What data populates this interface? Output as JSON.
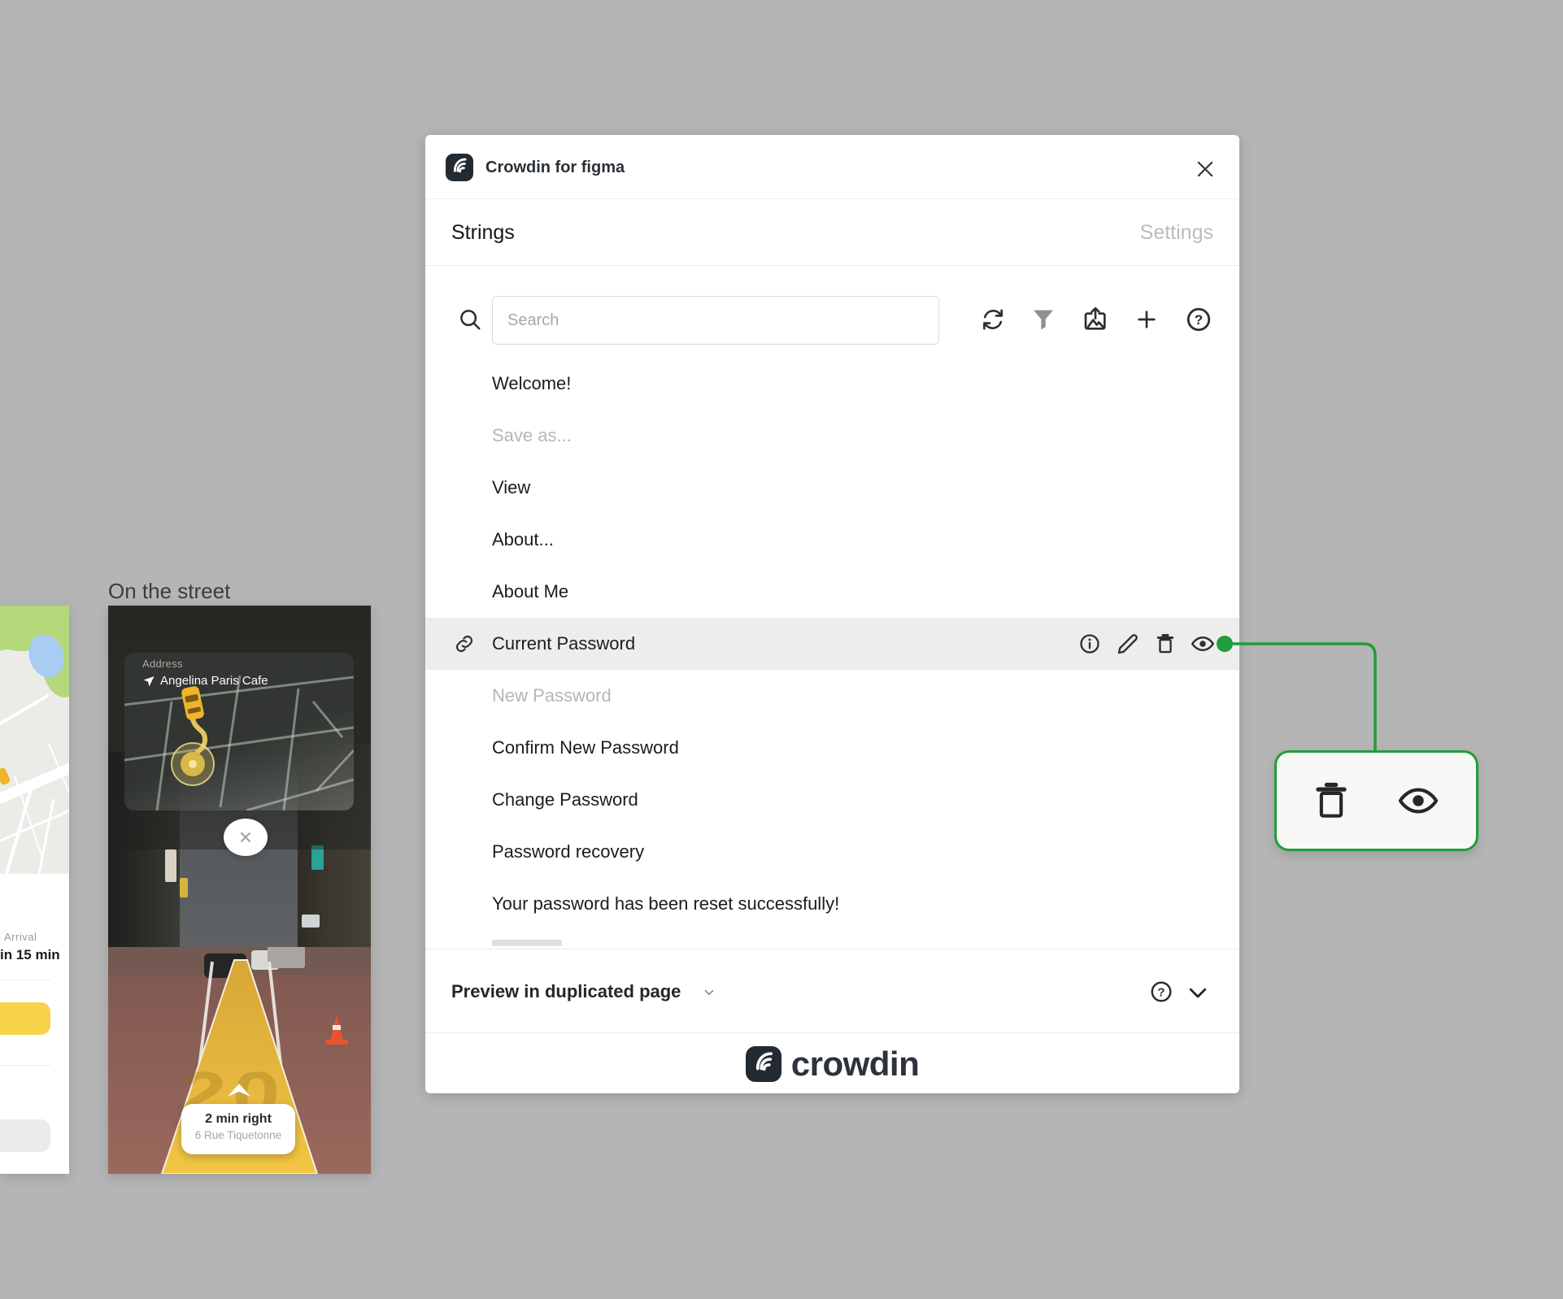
{
  "window": {
    "title": "Crowdin for figma"
  },
  "tabs": {
    "strings_label": "Strings",
    "settings_label": "Settings"
  },
  "toolbar": {
    "search_placeholder": "Search",
    "icons": [
      "search-icon",
      "sync-icon",
      "filter-icon",
      "upload-screenshot-icon",
      "add-string-icon",
      "help-icon"
    ]
  },
  "strings": {
    "items": [
      {
        "label": "Welcome!"
      },
      {
        "label": "Save as..."
      },
      {
        "label": "View"
      },
      {
        "label": "About..."
      },
      {
        "label": "About Me"
      },
      {
        "label": "Current Password"
      },
      {
        "label": "New Password"
      },
      {
        "label": "Confirm New Password"
      },
      {
        "label": "Change Password"
      },
      {
        "label": "Password recovery"
      },
      {
        "label": "Your password has been reset successfully!"
      }
    ],
    "selected_row_actions": [
      "info-icon",
      "edit-icon",
      "delete-icon",
      "preview-icon"
    ]
  },
  "callout": {
    "icons": [
      "delete-icon",
      "preview-icon"
    ]
  },
  "preview_bar": {
    "label": "Preview in duplicated page"
  },
  "footer": {
    "wordmark": "crowdin"
  },
  "artboards": {
    "street_label": "On the street",
    "address_label": "Address",
    "address_value": "Angelina Paris Cafe",
    "direction_primary": "2 min right",
    "direction_secondary": "6 Rue Tiquetonne",
    "path_number": "20",
    "arrival_label": "Arrival",
    "arrival_value": "in 15 min"
  },
  "colors": {
    "accent_green": "#1f9d3a",
    "canvas_bg": "#b5b5b5",
    "row_highlight": "#ededee",
    "logo_ink": "#232a31",
    "taxi_yellow": "#f0b429",
    "button_yellow": "#f7d24b"
  }
}
